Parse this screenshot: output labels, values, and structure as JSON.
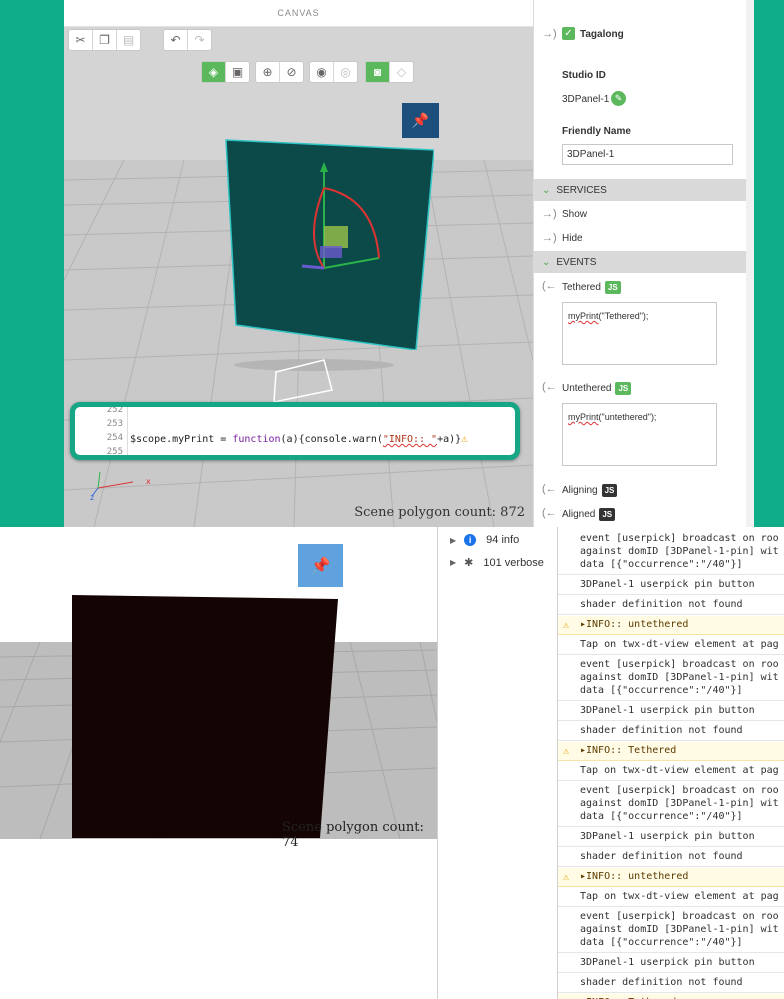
{
  "canvas": {
    "title": "CANVAS",
    "pin_label": "📌",
    "code": {
      "line_numbers": [
        "252",
        "253",
        "254",
        "255"
      ],
      "line_254_prefix": "$scope.myPrint = ",
      "line_254_keyword": "function",
      "line_254_mid": "(a){console.warn(",
      "line_254_string": "\"INFO:: \"",
      "line_254_suffix": "+a)}",
      "warn_icon": "⚠"
    },
    "polygon_count": "Scene polygon count: 872"
  },
  "properties": {
    "tagalong_label": "Tagalong",
    "studio_id_label": "Studio ID",
    "studio_id_value": "3DPanel-1",
    "friendly_name_label": "Friendly Name",
    "friendly_name_value": "3DPanel-1",
    "services_header": "SERVICES",
    "services": [
      "Show",
      "Hide"
    ],
    "events_header": "EVENTS",
    "tethered_label": "Tethered",
    "tethered_code_fn": "myPrint",
    "tethered_code_rest": "(\"Tethered\");",
    "untethered_label": "Untethered",
    "untethered_code_fn": "myPrint",
    "untethered_code_rest": "(\"untethered\");",
    "aligning_label": "Aligning",
    "aligned_label": "Aligned",
    "js_badge": "JS"
  },
  "preview": {
    "pin_label": "📌",
    "polygon_count": "Scene polygon count: 74"
  },
  "console": {
    "filters": [
      {
        "label": "94 info",
        "icon": "info-icon"
      },
      {
        "label": "101 verbose",
        "icon": "bug-icon"
      }
    ],
    "messages": [
      {
        "text": "event [userpick] broadcast on roo\nagainst domID [3DPanel-1-pin] wit\ndata [{\"occurrence\":\"/40\"}]",
        "type": "verbose"
      },
      {
        "text": "3DPanel-1 userpick pin button",
        "type": "verbose"
      },
      {
        "text": "shader definition not found",
        "type": "verbose"
      },
      {
        "text": "▸INFO:: untethered",
        "type": "warn"
      },
      {
        "text": "Tap on twx-dt-view element at pag",
        "type": "verbose"
      },
      {
        "text": "event [userpick] broadcast on roo\nagainst domID [3DPanel-1-pin] wit\ndata [{\"occurrence\":\"/40\"}]",
        "type": "verbose"
      },
      {
        "text": "3DPanel-1 userpick pin button",
        "type": "verbose"
      },
      {
        "text": "shader definition not found",
        "type": "verbose"
      },
      {
        "text": "▸INFO:: Tethered",
        "type": "warn"
      },
      {
        "text": "Tap on twx-dt-view element at pag",
        "type": "verbose"
      },
      {
        "text": "event [userpick] broadcast on roo\nagainst domID [3DPanel-1-pin] wit\ndata [{\"occurrence\":\"/40\"}]",
        "type": "verbose"
      },
      {
        "text": "3DPanel-1 userpick pin button",
        "type": "verbose"
      },
      {
        "text": "shader definition not found",
        "type": "verbose"
      },
      {
        "text": "▸INFO:: untethered",
        "type": "warn"
      },
      {
        "text": "Tap on twx-dt-view element at pag",
        "type": "verbose"
      },
      {
        "text": "event [userpick] broadcast on roo\nagainst domID [3DPanel-1-pin] wit\ndata [{\"occurrence\":\"/40\"}]",
        "type": "verbose"
      },
      {
        "text": "3DPanel-1 userpick pin button",
        "type": "verbose"
      },
      {
        "text": "shader definition not found",
        "type": "verbose"
      },
      {
        "text": "▸INFO:: Tethered",
        "type": "warn"
      }
    ]
  },
  "colors": {
    "accent": "#10ad8a",
    "panel": "#0c4a4a",
    "warn_bg": "#fffbe5"
  }
}
